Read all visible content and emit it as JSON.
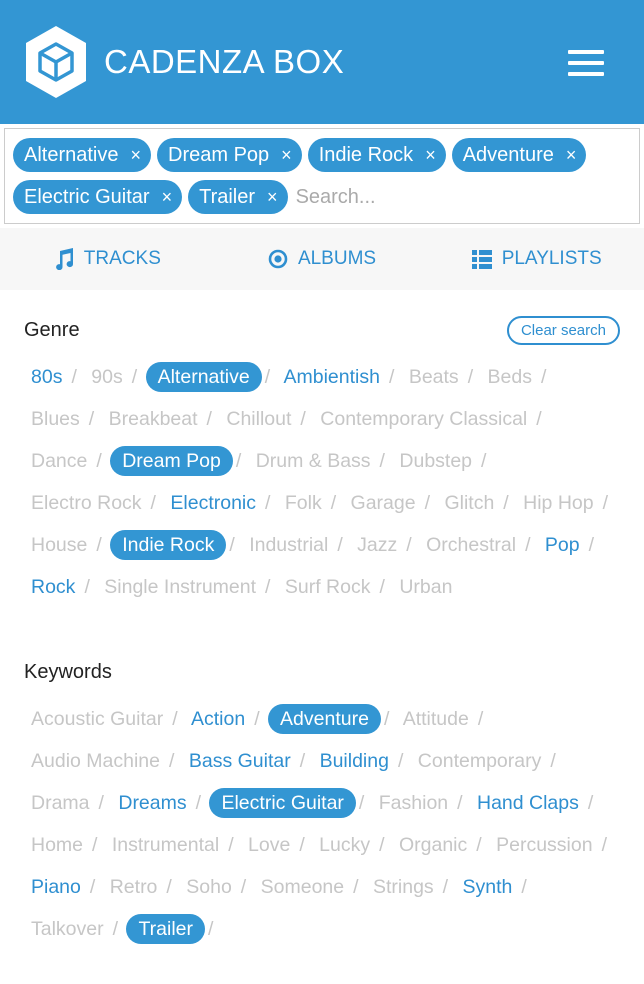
{
  "header": {
    "brand": "CADENZA BOX",
    "logo_icon": "cube-hexagon-icon",
    "menu_icon": "hamburger-icon",
    "color": "#3396d3"
  },
  "search": {
    "chips": [
      "Alternative",
      "Dream Pop",
      "Indie Rock",
      "Adventure",
      "Electric Guitar",
      "Trailer"
    ],
    "remove_glyph": "×",
    "placeholder": "Search...",
    "value": ""
  },
  "tabs": [
    {
      "label": "TRACKS",
      "icon": "music-note-icon"
    },
    {
      "label": "ALBUMS",
      "icon": "disc-icon"
    },
    {
      "label": "PLAYLISTS",
      "icon": "list-icon"
    }
  ],
  "genre": {
    "title": "Genre",
    "clear_label": "Clear search",
    "items": [
      {
        "label": "80s",
        "state": "available"
      },
      {
        "label": "90s",
        "state": "disabled"
      },
      {
        "label": "Alternative",
        "state": "selected"
      },
      {
        "label": "Ambientish",
        "state": "available"
      },
      {
        "label": "Beats",
        "state": "disabled"
      },
      {
        "label": "Beds",
        "state": "disabled"
      },
      {
        "label": "Blues",
        "state": "disabled"
      },
      {
        "label": "Breakbeat",
        "state": "disabled"
      },
      {
        "label": "Chillout",
        "state": "disabled"
      },
      {
        "label": "Contemporary Classical",
        "state": "disabled"
      },
      {
        "label": "Dance",
        "state": "disabled"
      },
      {
        "label": "Dream Pop",
        "state": "selected"
      },
      {
        "label": "Drum & Bass",
        "state": "disabled"
      },
      {
        "label": "Dubstep",
        "state": "disabled"
      },
      {
        "label": "Electro Rock",
        "state": "disabled"
      },
      {
        "label": "Electronic",
        "state": "available"
      },
      {
        "label": "Folk",
        "state": "disabled"
      },
      {
        "label": "Garage",
        "state": "disabled"
      },
      {
        "label": "Glitch",
        "state": "disabled"
      },
      {
        "label": "Hip Hop",
        "state": "disabled"
      },
      {
        "label": "House",
        "state": "disabled"
      },
      {
        "label": "Indie Rock",
        "state": "selected"
      },
      {
        "label": "Industrial",
        "state": "disabled"
      },
      {
        "label": "Jazz",
        "state": "disabled"
      },
      {
        "label": "Orchestral",
        "state": "disabled"
      },
      {
        "label": "Pop",
        "state": "available"
      },
      {
        "label": "Rock",
        "state": "available"
      },
      {
        "label": "Single Instrument",
        "state": "disabled"
      },
      {
        "label": "Surf Rock",
        "state": "disabled"
      },
      {
        "label": "Urban",
        "state": "disabled"
      }
    ]
  },
  "keywords": {
    "title": "Keywords",
    "items": [
      {
        "label": "Acoustic Guitar",
        "state": "disabled"
      },
      {
        "label": "Action",
        "state": "available"
      },
      {
        "label": "Adventure",
        "state": "selected"
      },
      {
        "label": "Attitude",
        "state": "disabled"
      },
      {
        "label": "Audio Machine",
        "state": "disabled"
      },
      {
        "label": "Bass Guitar",
        "state": "available"
      },
      {
        "label": "Building",
        "state": "available"
      },
      {
        "label": "Contemporary",
        "state": "disabled"
      },
      {
        "label": "Drama",
        "state": "disabled"
      },
      {
        "label": "Dreams",
        "state": "available"
      },
      {
        "label": "Electric Guitar",
        "state": "selected"
      },
      {
        "label": "Fashion",
        "state": "disabled"
      },
      {
        "label": "Hand Claps",
        "state": "available"
      },
      {
        "label": "Home",
        "state": "disabled"
      },
      {
        "label": "Instrumental",
        "state": "disabled"
      },
      {
        "label": "Love",
        "state": "disabled"
      },
      {
        "label": "Lucky",
        "state": "disabled"
      },
      {
        "label": "Organic",
        "state": "disabled"
      },
      {
        "label": "Percussion",
        "state": "disabled"
      },
      {
        "label": "Piano",
        "state": "available"
      },
      {
        "label": "Retro",
        "state": "disabled"
      },
      {
        "label": "Soho",
        "state": "disabled"
      },
      {
        "label": "Someone",
        "state": "disabled"
      },
      {
        "label": "Strings",
        "state": "disabled"
      },
      {
        "label": "Synth",
        "state": "available"
      },
      {
        "label": "Talkover",
        "state": "disabled"
      },
      {
        "label": "Trailer",
        "state": "selected"
      }
    ]
  },
  "separator": "/"
}
